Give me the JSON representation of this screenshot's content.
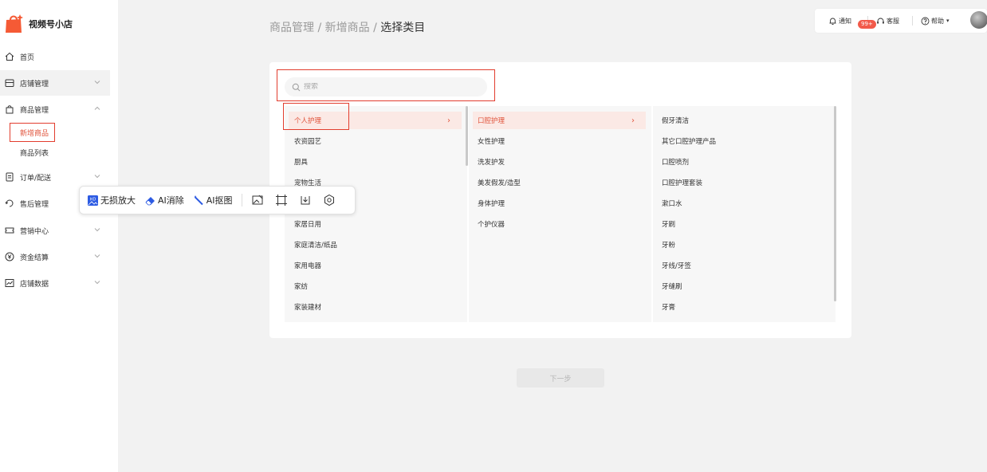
{
  "brand": {
    "name": "视频号小店",
    "accent": "#f55a35"
  },
  "sidebar": {
    "items": [
      {
        "label": "首页",
        "icon": "home-icon",
        "expandable": false
      },
      {
        "label": "店铺管理",
        "icon": "store-icon",
        "expandable": true
      },
      {
        "label": "商品管理",
        "icon": "bag-icon",
        "expandable": true,
        "expanded": true
      },
      {
        "label": "订单/配送",
        "icon": "order-icon",
        "expandable": true
      },
      {
        "label": "售后管理",
        "icon": "aftersale-icon",
        "expandable": true
      },
      {
        "label": "营销中心",
        "icon": "ticket-icon",
        "expandable": true
      },
      {
        "label": "资金结算",
        "icon": "yuan-icon",
        "expandable": true
      },
      {
        "label": "店铺数据",
        "icon": "chart-icon",
        "expandable": true
      }
    ],
    "sub_items": [
      {
        "label": "新增商品",
        "selected": true
      },
      {
        "label": "商品列表",
        "selected": false
      }
    ]
  },
  "breadcrumb": {
    "part1": "商品管理",
    "sep1": " / ",
    "part2": "新增商品",
    "sep2": " / ",
    "current": "选择类目"
  },
  "topbar": {
    "notice": "通知",
    "notice_badge": "99+",
    "service": "客服",
    "help": "帮助"
  },
  "search": {
    "placeholder": "搜索",
    "value": ""
  },
  "columns": {
    "level1": [
      "个人护理",
      "农资园艺",
      "厨具",
      "宠物生活",
      "",
      "家居日用",
      "家庭清洁/纸品",
      "家用电器",
      "家纺",
      "家装建材"
    ],
    "level2": [
      "口腔护理",
      "女性护理",
      "洗发护发",
      "美发假发/造型",
      "身体护理",
      "个护仪器"
    ],
    "level3": [
      "假牙清洁",
      "其它口腔护理产品",
      "口腔喷剂",
      "口腔护理套装",
      "漱口水",
      "牙刷",
      "牙粉",
      "牙线/牙签",
      "牙缝刷",
      "牙膏"
    ]
  },
  "selected": {
    "level1": "个人护理",
    "level2": "口腔护理"
  },
  "toolbar": {
    "upscale": "无损放大",
    "erase": "AI消除",
    "cutout": "AI抠图"
  },
  "next_button": "下一步",
  "colors": {
    "highlight": "#e0533b",
    "annotation_box": "#e23d2e",
    "badge": "#f25a4a"
  }
}
